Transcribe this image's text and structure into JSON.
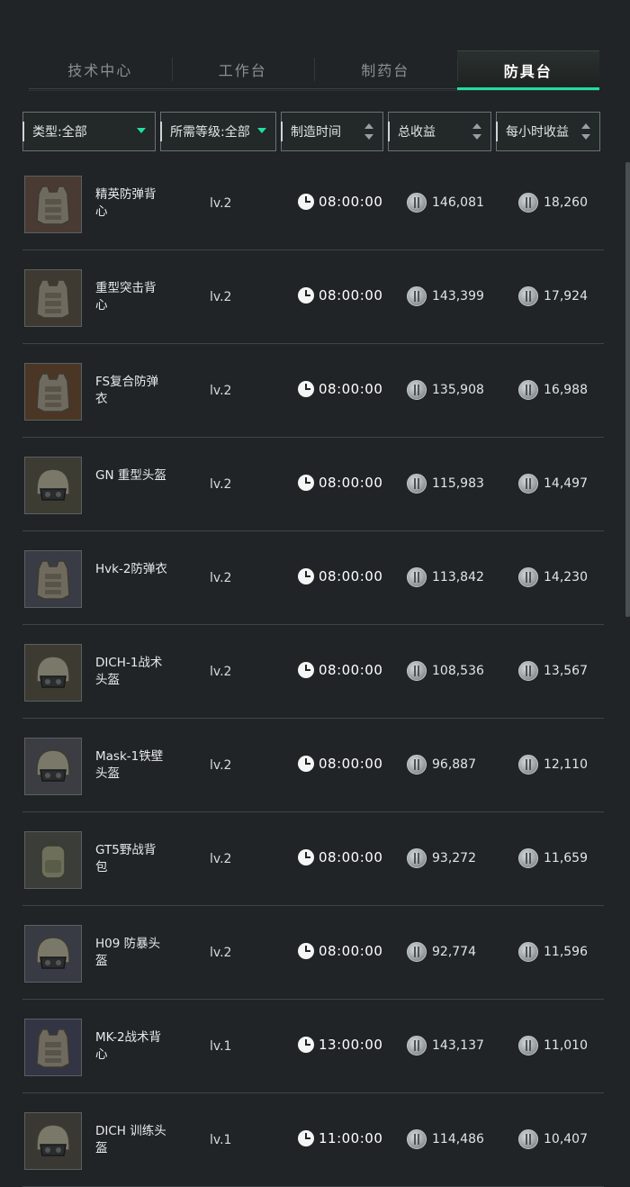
{
  "tabs": [
    {
      "label": "技术中心",
      "active": false
    },
    {
      "label": "工作台",
      "active": false
    },
    {
      "label": "制药台",
      "active": false
    },
    {
      "label": "防具台",
      "active": true
    }
  ],
  "filters": {
    "type": "类型:全部",
    "level": "所需等级:全部",
    "craft_time": "制造时间",
    "total_profit": "总收益",
    "hourly_profit": "每小时收益"
  },
  "accent_color": "#1fe0a0",
  "items": [
    {
      "name": "精英防弹背心",
      "level": "lv.2",
      "time": "08:00:00",
      "total": "146,081",
      "hourly": "18,260",
      "icon": "vest-icon"
    },
    {
      "name": "重型突击背心",
      "level": "lv.2",
      "time": "08:00:00",
      "total": "143,399",
      "hourly": "17,924",
      "icon": "vest-icon"
    },
    {
      "name": "FS复合防弹衣",
      "level": "lv.2",
      "time": "08:00:00",
      "total": "135,908",
      "hourly": "16,988",
      "icon": "vest-icon"
    },
    {
      "name": "GN 重型头盔",
      "level": "lv.2",
      "time": "08:00:00",
      "total": "115,983",
      "hourly": "14,497",
      "icon": "helmet-icon"
    },
    {
      "name": "Hvk-2防弹衣",
      "level": "lv.2",
      "time": "08:00:00",
      "total": "113,842",
      "hourly": "14,230",
      "icon": "vest-icon"
    },
    {
      "name": "DICH-1战术头盔",
      "level": "lv.2",
      "time": "08:00:00",
      "total": "108,536",
      "hourly": "13,567",
      "icon": "helmet-icon"
    },
    {
      "name": "Mask-1铁壁头盔",
      "level": "lv.2",
      "time": "08:00:00",
      "total": "96,887",
      "hourly": "12,110",
      "icon": "helmet-icon"
    },
    {
      "name": "GT5野战背包",
      "level": "lv.2",
      "time": "08:00:00",
      "total": "93,272",
      "hourly": "11,659",
      "icon": "backpack-icon"
    },
    {
      "name": "H09 防暴头盔",
      "level": "lv.2",
      "time": "08:00:00",
      "total": "92,774",
      "hourly": "11,596",
      "icon": "helmet-icon"
    },
    {
      "name": "MK-2战术背心",
      "level": "lv.1",
      "time": "13:00:00",
      "total": "143,137",
      "hourly": "11,010",
      "icon": "vest-icon"
    },
    {
      "name": "DICH 训练头盔",
      "level": "lv.1",
      "time": "11:00:00",
      "total": "114,486",
      "hourly": "10,407",
      "icon": "helmet-icon"
    }
  ]
}
